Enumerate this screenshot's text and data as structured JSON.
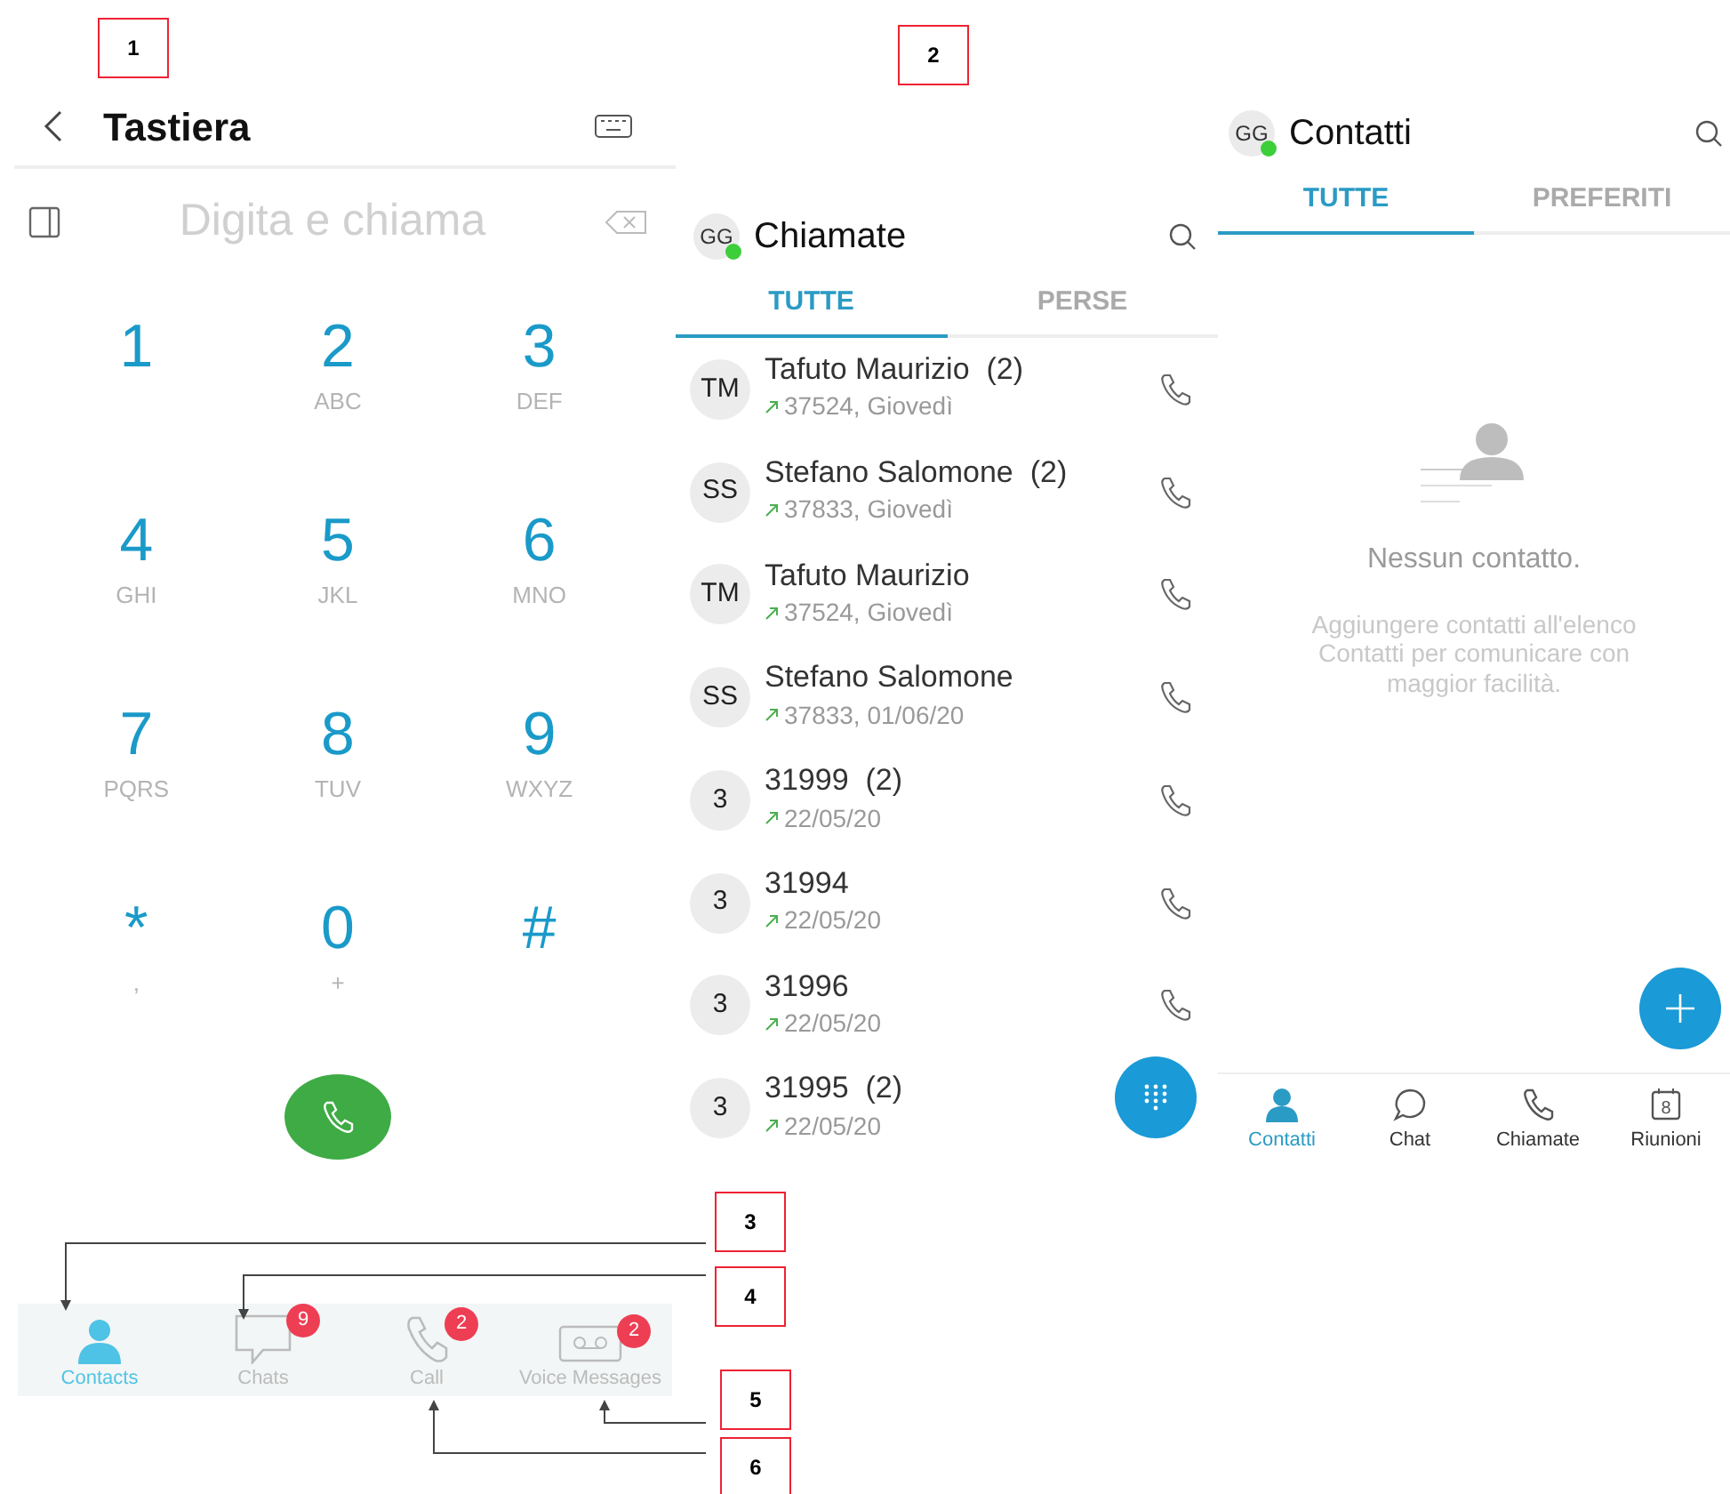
{
  "annotations": [
    {
      "label": "1"
    },
    {
      "label": "2"
    },
    {
      "label": "3"
    },
    {
      "label": "4"
    },
    {
      "label": "5"
    },
    {
      "label": "6"
    }
  ],
  "dialer": {
    "title": "Tastiera",
    "placeholder": "Digita e chiama",
    "keys": [
      {
        "digit": "1"
      },
      {
        "digit": "2",
        "letters": "ABC"
      },
      {
        "digit": "3",
        "letters": "DEF"
      },
      {
        "digit": "4",
        "letters": "GHI"
      },
      {
        "digit": "5",
        "letters": "JKL"
      },
      {
        "digit": "6",
        "letters": "MNO"
      },
      {
        "digit": "7",
        "letters": "PQRS"
      },
      {
        "digit": "8",
        "letters": "TUV"
      },
      {
        "digit": "9",
        "letters": "WXYZ"
      },
      {
        "digit": "*",
        "letters": ","
      },
      {
        "digit": "0",
        "letters": "+"
      },
      {
        "digit": "#"
      }
    ]
  },
  "calls": {
    "avatar": "GG",
    "title": "Chiamate",
    "tabs": [
      {
        "label": "TUTTE",
        "selected": true
      },
      {
        "label": "PERSE",
        "selected": false
      }
    ],
    "rows": [
      {
        "initials": "TM",
        "name": "Tafuto Maurizio",
        "count": "(2)",
        "detail": "37524, Giovedì"
      },
      {
        "initials": "SS",
        "name": "Stefano Salomone",
        "count": "(2)",
        "detail": "37833, Giovedì"
      },
      {
        "initials": "TM",
        "name": "Tafuto Maurizio",
        "detail": "37524, Giovedì"
      },
      {
        "initials": "SS",
        "name": "Stefano Salomone",
        "detail": "37833, 01/06/20"
      },
      {
        "initials": "3",
        "name": "31999",
        "count": "(2)",
        "detail": "22/05/20"
      },
      {
        "initials": "3",
        "name": "31994",
        "detail": "22/05/20"
      },
      {
        "initials": "3",
        "name": "31996",
        "detail": "22/05/20"
      },
      {
        "initials": "3",
        "name": "31995",
        "count": "(2)",
        "detail": "22/05/20"
      }
    ]
  },
  "contacts": {
    "avatar": "GG",
    "title": "Contatti",
    "tabs": [
      {
        "label": "TUTTE",
        "selected": true
      },
      {
        "label": "PREFERITI",
        "selected": false
      }
    ],
    "empty_title": "Nessun contatto.",
    "empty_text": "Aggiungere contatti all'elenco Contatti per comunicare con maggior facilità.",
    "nav": [
      {
        "kind": "person",
        "label": "Contatti",
        "selected": true
      },
      {
        "kind": "chat",
        "label": "Chat",
        "selected": false
      },
      {
        "kind": "phone",
        "label": "Chiamate",
        "selected": false
      },
      {
        "kind": "calendar",
        "label": "Riunioni",
        "selected": false,
        "icon_text": "8"
      }
    ]
  },
  "tab_bar": [
    {
      "kind": "person",
      "label": "Contacts",
      "selected": true
    },
    {
      "kind": "chat",
      "label": "Chats",
      "selected": false,
      "badge": "9"
    },
    {
      "kind": "phone",
      "label": "Call",
      "selected": false,
      "badge": "2"
    },
    {
      "kind": "voicemail",
      "label": "Voice Messages",
      "selected": false,
      "badge": "2"
    }
  ]
}
